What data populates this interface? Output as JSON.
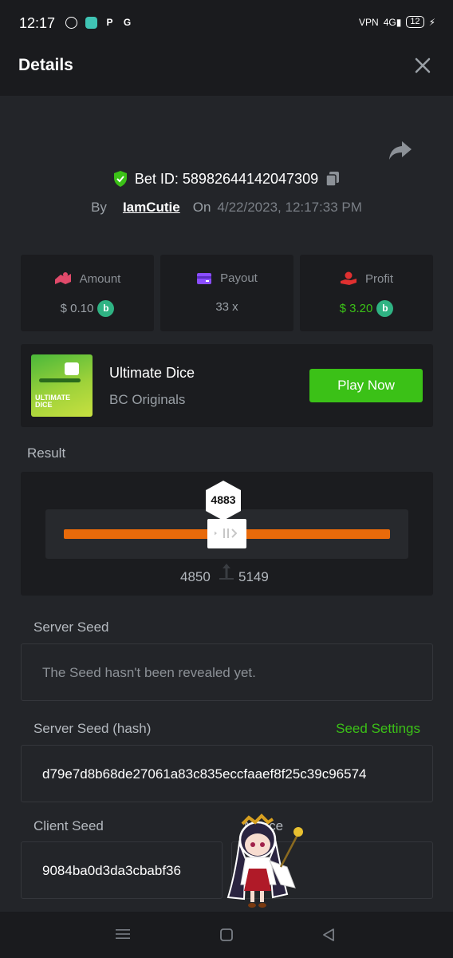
{
  "status_bar": {
    "time": "12:17",
    "network": "4G",
    "battery": "12"
  },
  "header": {
    "title": "Details"
  },
  "bet": {
    "bet_id_label": "Bet ID: 58982644142047309",
    "by_label": "By",
    "username": "IamCutie",
    "on_label": "On",
    "datetime": "4/22/2023, 12:17:33 PM"
  },
  "stats": {
    "amount_label": "Amount",
    "amount_value": "$ 0.10",
    "payout_label": "Payout",
    "payout_value": "33 x",
    "profit_label": "Profit",
    "profit_value": "$ 3.20",
    "profit_color": "#3bc117"
  },
  "game": {
    "name": "Ultimate Dice",
    "provider": "BC Originals",
    "thumb_text": "ULTIMATE DICE",
    "play_label": "Play Now"
  },
  "result": {
    "label": "Result",
    "roll": "4883",
    "range_low": "4850",
    "range_high": "5149"
  },
  "seeds": {
    "server_seed_label": "Server Seed",
    "server_seed_placeholder": "The Seed hasn't been revealed yet.",
    "server_hash_label": "Server Seed (hash)",
    "seed_settings_label": "Seed Settings",
    "server_hash": "d79e7d8b68de27061a83c835eccfaaef8f25c39c96574",
    "client_seed_label": "Client Seed",
    "nonce_label": "Nonce",
    "client_seed": "9084ba0d3da3cbabf36"
  },
  "colors": {
    "accent_green": "#3bc117",
    "track_orange": "#e86a0a",
    "coin": "#2fb383"
  }
}
